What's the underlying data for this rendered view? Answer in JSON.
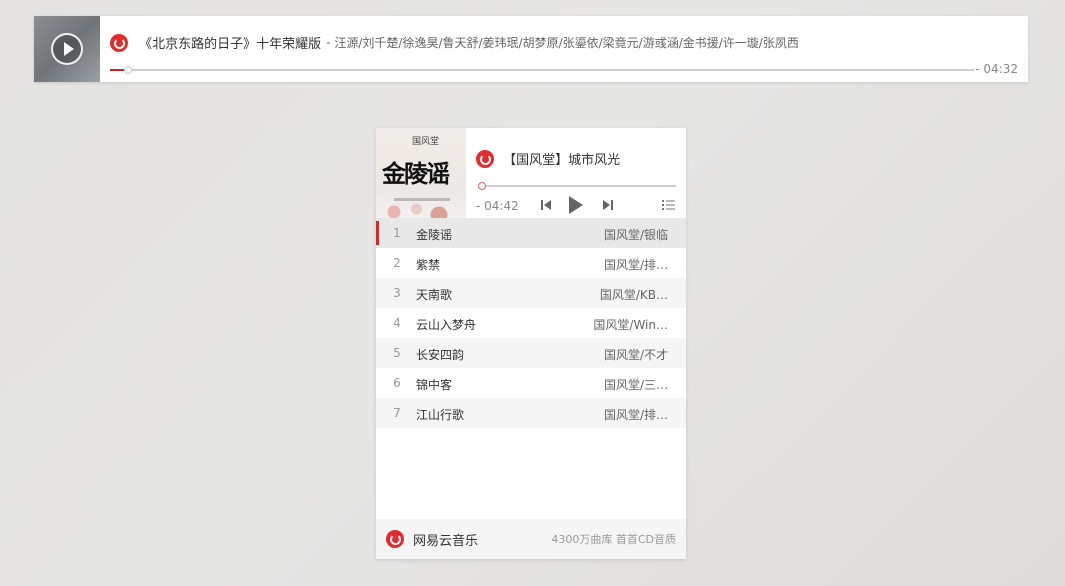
{
  "bar_player": {
    "song_title": "《北京东路的日子》十年荣耀版",
    "separator": " - ",
    "artists": "汪源/刘千楚/徐逸昊/鲁天舒/姜玮珉/胡梦原/张鎏依/梁竟元/游彧涵/金书援/许一璇/张夙西",
    "time": "- 04:32",
    "cover_icon": "play-circle-icon",
    "progress": 0.016
  },
  "card_player": {
    "playlist_title": "【国风堂】城市风光",
    "album_cover_text": "金陵谣",
    "album_stamp": "国风堂",
    "time": "- 04:42",
    "progress": 0.0,
    "controls": {
      "prev_icon": "skip-previous-icon",
      "play_icon": "play-icon",
      "next_icon": "skip-next-icon",
      "list_icon": "playlist-icon"
    },
    "tracks": [
      {
        "num": "1",
        "name": "金陵谣",
        "artist": "国风堂/银临"
      },
      {
        "num": "2",
        "name": "紫禁",
        "artist": "国风堂/排…"
      },
      {
        "num": "3",
        "name": "天南歌",
        "artist": "国风堂/KB…"
      },
      {
        "num": "4",
        "name": "云山入梦舟",
        "artist": "国风堂/Win…"
      },
      {
        "num": "5",
        "name": "长安四韵",
        "artist": "国风堂/不才"
      },
      {
        "num": "6",
        "name": "锦中客",
        "artist": "国风堂/三…"
      },
      {
        "num": "7",
        "name": "江山行歌",
        "artist": "国风堂/排…"
      }
    ],
    "footer": {
      "brand": "网易云音乐",
      "quality": "4300万曲库 首首CD音质"
    }
  },
  "colors": {
    "accent_red": "#c62f2f",
    "logo_red": "#e22b2b"
  }
}
